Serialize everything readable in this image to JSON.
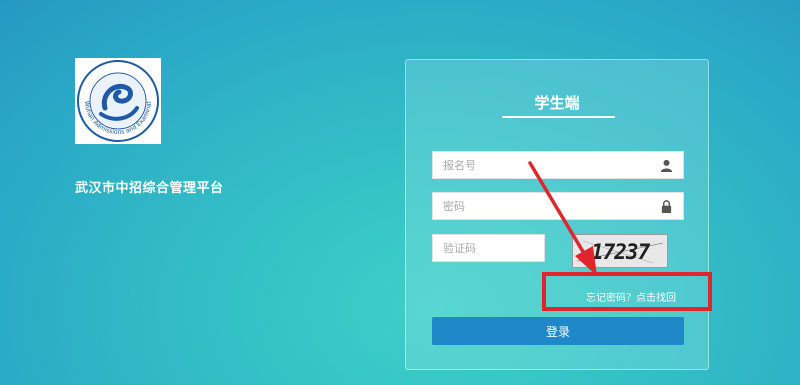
{
  "logo": {
    "icon": "wuhan-admissions-logo-icon",
    "ring_text": "Wuhan Admissions and Examinations"
  },
  "platform": {
    "title": "武汉市中招综合管理平台"
  },
  "login": {
    "panel_title": "学生端",
    "username": {
      "placeholder": "报名号",
      "icon": "user-icon"
    },
    "password": {
      "placeholder": "密码",
      "icon": "lock-icon"
    },
    "captcha": {
      "placeholder": "验证码",
      "image_text": "17237"
    },
    "forgot_text": "忘记密码？点击找回",
    "submit_label": "登录"
  },
  "annotation": {
    "color": "#e0262c"
  },
  "colors": {
    "button": "#1e88c8",
    "background": "#34c0c6"
  }
}
